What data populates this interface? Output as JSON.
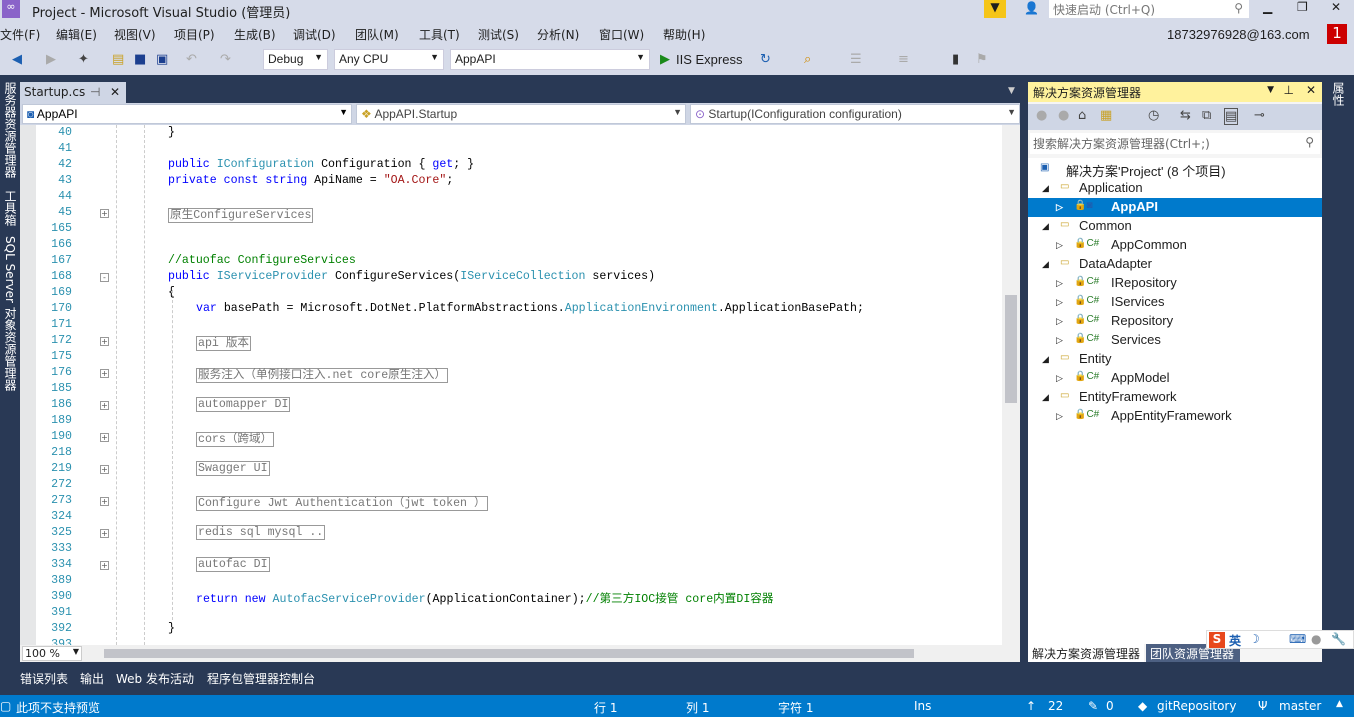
{
  "window": {
    "title": "Project - Microsoft Visual Studio (管理员)",
    "quick_launch_placeholder": "快速启动 (Ctrl+Q)",
    "account": "18732976928@163.com",
    "notification_count": "1"
  },
  "menu": [
    "文件(F)",
    "编辑(E)",
    "视图(V)",
    "项目(P)",
    "生成(B)",
    "调试(D)",
    "团队(M)",
    "工具(T)",
    "测试(S)",
    "分析(N)",
    "窗口(W)",
    "帮助(H)"
  ],
  "toolbar": {
    "config": "Debug",
    "platform": "Any CPU",
    "startup_project": "AppAPI",
    "run_label": "IIS Express"
  },
  "editor": {
    "tab": "Startup.cs",
    "nav_project": "AppAPI",
    "nav_class": "AppAPI.Startup",
    "nav_member": "Startup(IConfiguration configuration)",
    "zoom": "100 %",
    "lines": [
      {
        "n": "40",
        "i": 2,
        "s": [
          [
            "}",
            ""
          ]
        ]
      },
      {
        "n": "41",
        "i": 2,
        "s": []
      },
      {
        "n": "42",
        "i": 2,
        "s": [
          [
            "public ",
            "kw"
          ],
          [
            "IConfiguration",
            "ty"
          ],
          [
            " Configuration { ",
            ""
          ],
          [
            "get",
            "kw"
          ],
          [
            "; }",
            ""
          ]
        ]
      },
      {
        "n": "43",
        "i": 2,
        "s": [
          [
            "private const string ",
            "kw"
          ],
          [
            "ApiName = ",
            ""
          ],
          [
            "\"OA.Core\"",
            "st"
          ],
          [
            ";",
            ""
          ]
        ]
      },
      {
        "n": "44",
        "i": 2,
        "s": []
      },
      {
        "n": "45",
        "i": 2,
        "f": "+",
        "s": [
          [
            "原生ConfigureServices",
            "box"
          ]
        ]
      },
      {
        "n": "165",
        "i": 2,
        "s": []
      },
      {
        "n": "166",
        "i": 2,
        "s": []
      },
      {
        "n": "167",
        "i": 2,
        "s": [
          [
            "//atuofac ConfigureServices",
            "cm"
          ]
        ]
      },
      {
        "n": "168",
        "i": 2,
        "f": "-",
        "s": [
          [
            "public ",
            "kw"
          ],
          [
            "IServiceProvider",
            "ty"
          ],
          [
            " ConfigureServices(",
            ""
          ],
          [
            "IServiceCollection",
            "ty"
          ],
          [
            " services)",
            ""
          ]
        ]
      },
      {
        "n": "169",
        "i": 2,
        "s": [
          [
            "{",
            ""
          ]
        ]
      },
      {
        "n": "170",
        "i": 3,
        "s": [
          [
            "var ",
            "kw"
          ],
          [
            "basePath = Microsoft.DotNet.PlatformAbstractions.",
            ""
          ],
          [
            "ApplicationEnvironment",
            "ty"
          ],
          [
            ".ApplicationBasePath;",
            ""
          ]
        ]
      },
      {
        "n": "171",
        "i": 3,
        "s": []
      },
      {
        "n": "172",
        "i": 3,
        "f": "+",
        "s": [
          [
            "api 版本",
            "box"
          ]
        ]
      },
      {
        "n": "175",
        "i": 3,
        "s": []
      },
      {
        "n": "176",
        "i": 3,
        "f": "+",
        "s": [
          [
            "服务注入（单例接口注入.net core原生注入）",
            "box"
          ]
        ]
      },
      {
        "n": "185",
        "i": 3,
        "s": []
      },
      {
        "n": "186",
        "i": 3,
        "f": "+",
        "s": [
          [
            "automapper DI",
            "box"
          ]
        ]
      },
      {
        "n": "189",
        "i": 3,
        "s": []
      },
      {
        "n": "190",
        "i": 3,
        "f": "+",
        "s": [
          [
            "cors（跨域）",
            "box"
          ]
        ]
      },
      {
        "n": "218",
        "i": 3,
        "s": []
      },
      {
        "n": "219",
        "i": 3,
        "f": "+",
        "s": [
          [
            "Swagger UI",
            "box"
          ]
        ]
      },
      {
        "n": "272",
        "i": 3,
        "s": []
      },
      {
        "n": "273",
        "i": 3,
        "f": "+",
        "s": [
          [
            "Configure Jwt Authentication（jwt token ）",
            "box"
          ]
        ]
      },
      {
        "n": "324",
        "i": 3,
        "s": []
      },
      {
        "n": "325",
        "i": 3,
        "f": "+",
        "s": [
          [
            "redis sql mysql ..",
            "box"
          ]
        ]
      },
      {
        "n": "333",
        "i": 3,
        "s": []
      },
      {
        "n": "334",
        "i": 3,
        "f": "+",
        "s": [
          [
            "autofac DI",
            "box"
          ]
        ]
      },
      {
        "n": "389",
        "i": 3,
        "s": []
      },
      {
        "n": "390",
        "i": 3,
        "s": [
          [
            "return new ",
            "kw"
          ],
          [
            "AutofacServiceProvider",
            "ty"
          ],
          [
            "(ApplicationContainer);",
            ""
          ],
          [
            "//第三方IOC接管 core内置DI容器",
            "cm"
          ]
        ]
      },
      {
        "n": "391",
        "i": 3,
        "s": []
      },
      {
        "n": "392",
        "i": 2,
        "s": [
          [
            "}",
            ""
          ]
        ]
      },
      {
        "n": "393",
        "i": 2,
        "s": []
      }
    ]
  },
  "solution_explorer": {
    "title": "解决方案资源管理器",
    "search_placeholder": "搜索解决方案资源管理器(Ctrl+;)",
    "items": [
      {
        "label": "解决方案'Project' (8 个项目)",
        "level": 0,
        "type": "solution"
      },
      {
        "label": "Application",
        "level": 1,
        "type": "folder"
      },
      {
        "label": "AppAPI",
        "level": 2,
        "type": "web",
        "selected": true
      },
      {
        "label": "Common",
        "level": 1,
        "type": "folder"
      },
      {
        "label": "AppCommon",
        "level": 2,
        "type": "csharp"
      },
      {
        "label": "DataAdapter",
        "level": 1,
        "type": "folder"
      },
      {
        "label": "IRepository",
        "level": 2,
        "type": "csharp"
      },
      {
        "label": "IServices",
        "level": 2,
        "type": "csharp"
      },
      {
        "label": "Repository",
        "level": 2,
        "type": "csharp"
      },
      {
        "label": "Services",
        "level": 2,
        "type": "csharp"
      },
      {
        "label": "Entity",
        "level": 1,
        "type": "folder"
      },
      {
        "label": "AppModel",
        "level": 2,
        "type": "csharp"
      },
      {
        "label": "EntityFramework",
        "level": 1,
        "type": "folder"
      },
      {
        "label": "AppEntityFramework",
        "level": 2,
        "type": "csharp"
      }
    ],
    "tabs": [
      "解决方案资源管理器",
      "团队资源管理器"
    ]
  },
  "left_tabs": [
    "服务器资源管理器",
    "工具箱",
    "SQL Server 对象资源管理器"
  ],
  "right_tabs": [
    "属性"
  ],
  "bottom_tabs": [
    "错误列表",
    "输出",
    "Web 发布活动",
    "程序包管理器控制台"
  ],
  "ime": {
    "lang": "英"
  },
  "status": {
    "message": "此项不支持预览",
    "line": "行 1",
    "col": "列 1",
    "char": "字符 1",
    "mode": "Ins",
    "push": "22",
    "changes": "0",
    "repo": "gitRepository",
    "branch": "master"
  },
  "colors": {
    "accent": "#007acc",
    "chrome": "#d6dbe9",
    "dark": "#293955",
    "sol_title": "#fff29d"
  }
}
